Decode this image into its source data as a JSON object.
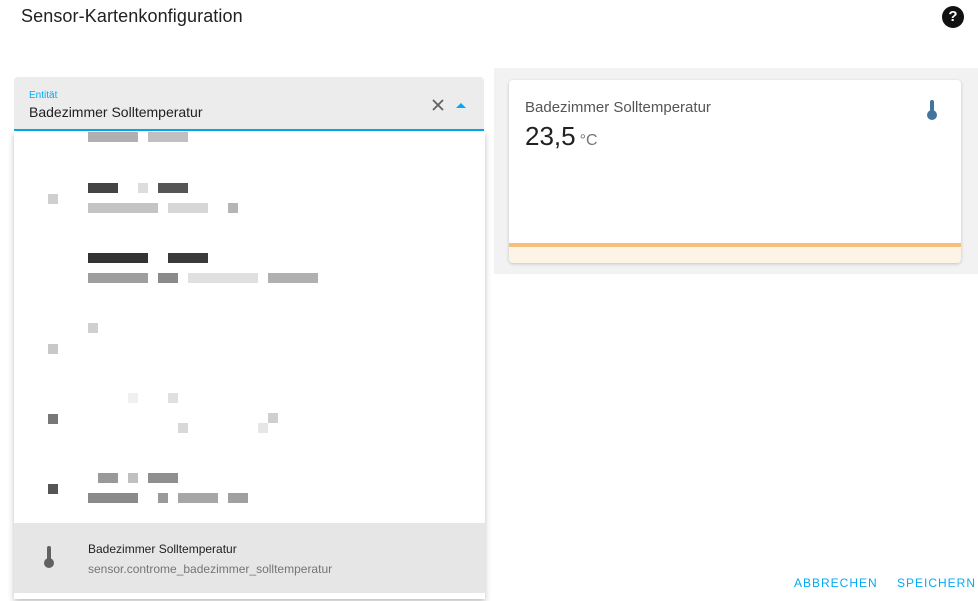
{
  "dialog": {
    "title": "Sensor-Kartenkonfiguration",
    "help_icon": "question-circle-icon"
  },
  "entity_field": {
    "label": "Entität",
    "value": "Badezimmer Solltemperatur",
    "clear_icon": "close-icon",
    "toggle_icon": "caret-up-icon"
  },
  "dropdown": {
    "selected_item": {
      "primary": "Badezimmer Solltemperatur",
      "secondary": "sensor.controme_badezimmer_solltemperatur",
      "icon": "thermometer-icon"
    }
  },
  "preview_card": {
    "name": "Badezimmer Solltemperatur",
    "value": "23,5",
    "unit": "°C",
    "icon": "thermometer-icon",
    "accent_color": "#f6bf7c"
  },
  "actions": {
    "cancel_label": "ABBRECHEN",
    "save_label": "SPEICHERN"
  },
  "colors": {
    "primary": "#03a9f4",
    "field_bg": "#ececec",
    "selected_bg": "#e6e6e6"
  }
}
